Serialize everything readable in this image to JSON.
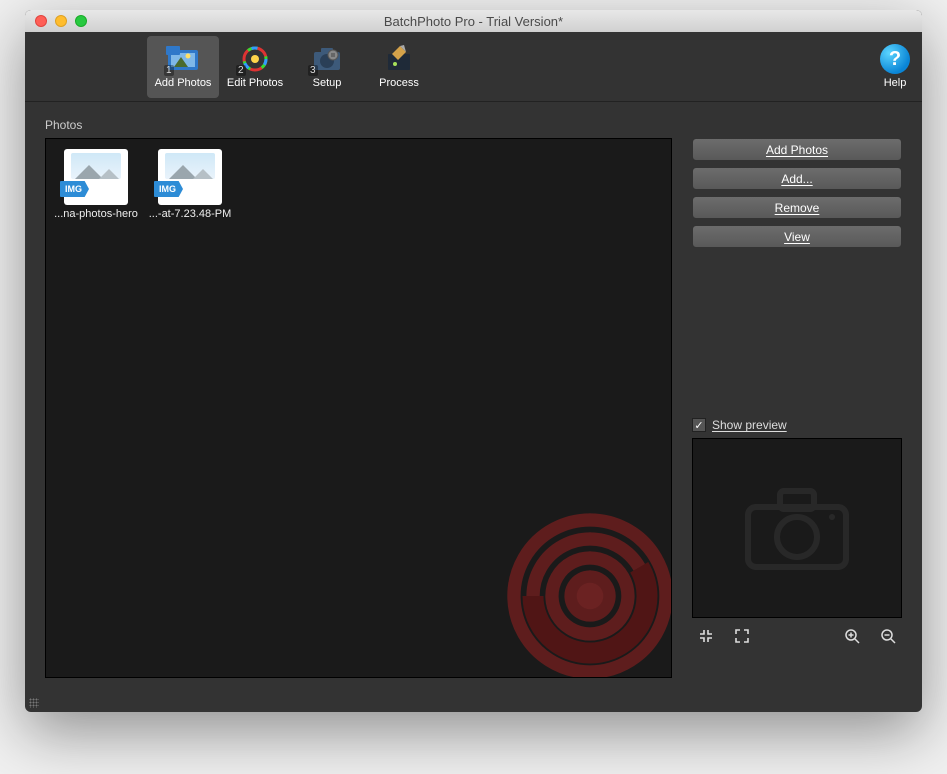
{
  "window": {
    "title": "BatchPhoto Pro - Trial Version*"
  },
  "toolbar": {
    "items": [
      {
        "label": "Add Photos",
        "num": "1"
      },
      {
        "label": "Edit Photos",
        "num": "2"
      },
      {
        "label": "Setup",
        "num": "3"
      },
      {
        "label": "Process",
        "num": ""
      }
    ],
    "help": "Help"
  },
  "photos": {
    "section_label": "Photos",
    "items": [
      {
        "label": "...na-photos-hero",
        "badge": "IMG"
      },
      {
        "label": "...-at-7.23.48-PM",
        "badge": "IMG"
      }
    ]
  },
  "side": {
    "buttons": {
      "add_photos": "Add Photos",
      "add": "Add...",
      "remove": "Remove",
      "view": "View"
    },
    "preview": {
      "check_label": "Show preview",
      "checked": "✓"
    }
  }
}
